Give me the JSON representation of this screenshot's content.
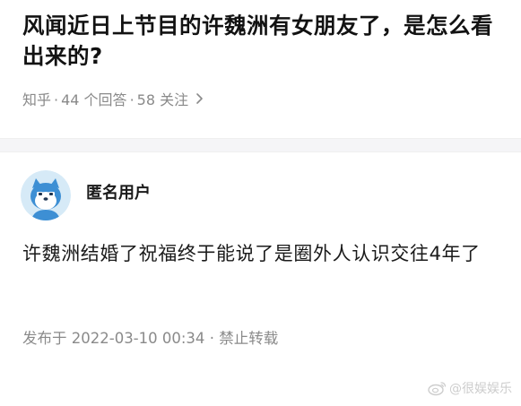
{
  "question": {
    "title": "风闻近日上节目的许魏洲有女朋友了，是怎么看出来的?",
    "source": "知乎",
    "answers": "44 个回答",
    "follows": "58 关注",
    "chevron_icon": "chevron-right-icon"
  },
  "answer": {
    "author": "匿名用户",
    "avatar_icon": "anonymous-avatar-icon",
    "content": "许魏洲结婚了祝福终于能说了是圈外人认识交往4年了",
    "published": "发布于 2022-03-10 00:34",
    "copyright": "禁止转载"
  },
  "watermark": {
    "text": "@很娱娱乐",
    "logo": "weibo-logo"
  },
  "colors": {
    "title": "#121212",
    "meta": "#8a8a8a",
    "divider": "#f5f5f7",
    "avatar_bg": "#d6eaf7",
    "avatar_head": "#3d8fd4"
  }
}
